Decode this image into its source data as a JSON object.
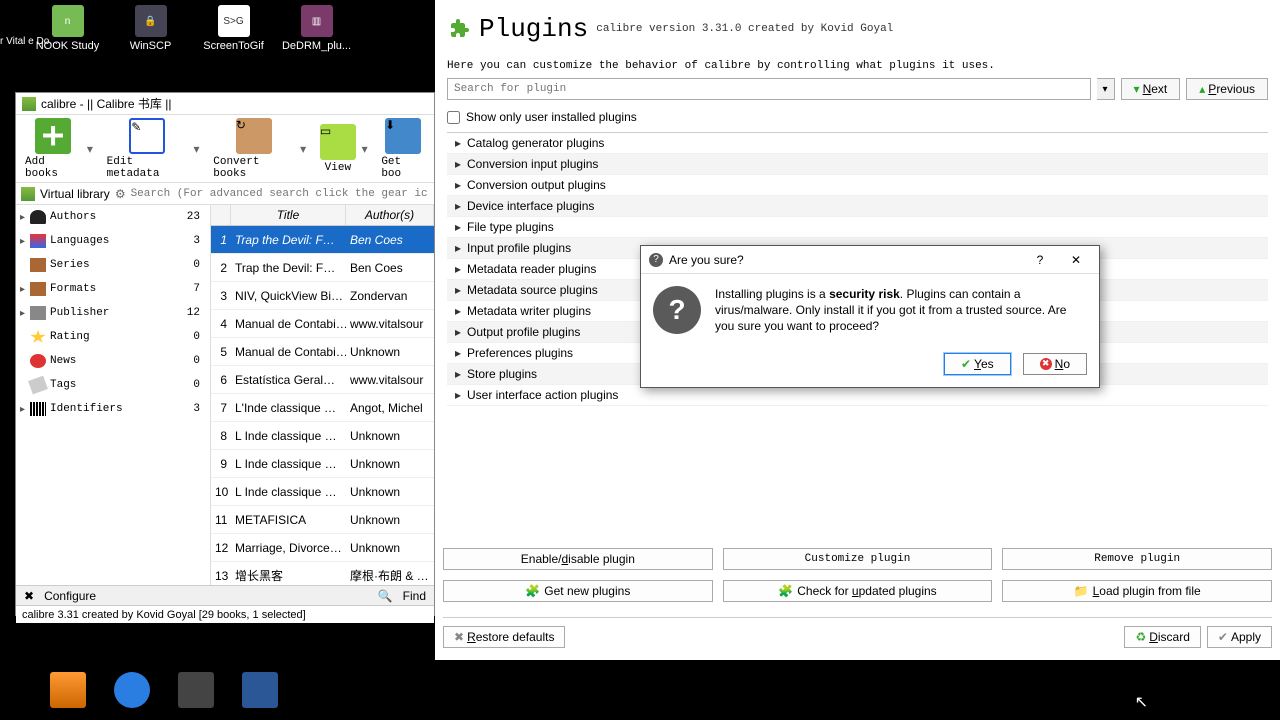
{
  "desktop": {
    "icons": [
      {
        "label": "NOOK Study"
      },
      {
        "label": "WinSCP"
      },
      {
        "label": "ScreenToGif"
      },
      {
        "label": "DeDRM_plu..."
      }
    ],
    "partial_left": "r Vital\ne Do..."
  },
  "calibre": {
    "title": "calibre - || Calibre 书库 ||",
    "toolbar": {
      "add": "Add books",
      "edit": "Edit metadata",
      "convert": "Convert books",
      "view": "View",
      "get": "Get boo"
    },
    "virtual_lib": "Virtual library",
    "search_placeholder": "Search (For advanced search click the gear ic",
    "sidebar": [
      {
        "label": "Authors",
        "count": "23"
      },
      {
        "label": "Languages",
        "count": "3"
      },
      {
        "label": "Series",
        "count": "0"
      },
      {
        "label": "Formats",
        "count": "7"
      },
      {
        "label": "Publisher",
        "count": "12"
      },
      {
        "label": "Rating",
        "count": "0"
      },
      {
        "label": "News",
        "count": "0"
      },
      {
        "label": "Tags",
        "count": "0"
      },
      {
        "label": "Identifiers",
        "count": "3"
      }
    ],
    "cols": {
      "title": "Title",
      "author": "Author(s)"
    },
    "rows": [
      {
        "n": "1",
        "t": "Trap the Devil: F…",
        "a": "Ben Coes"
      },
      {
        "n": "2",
        "t": "Trap the Devil: F…",
        "a": "Ben Coes"
      },
      {
        "n": "3",
        "t": "NIV, QuickView Bi…",
        "a": "Zondervan"
      },
      {
        "n": "4",
        "t": "Manual de Contabi…",
        "a": "www.vitalsour"
      },
      {
        "n": "5",
        "t": "Manual de Contabi…",
        "a": "Unknown"
      },
      {
        "n": "6",
        "t": "Estatística Geral…",
        "a": "www.vitalsour"
      },
      {
        "n": "7",
        "t": "L'Inde classique …",
        "a": "Angot, Michel"
      },
      {
        "n": "8",
        "t": "L Inde classique …",
        "a": "Unknown"
      },
      {
        "n": "9",
        "t": "L Inde classique …",
        "a": "Unknown"
      },
      {
        "n": "10",
        "t": "L Inde classique …",
        "a": "Unknown"
      },
      {
        "n": "11",
        "t": "METAFISICA",
        "a": "Unknown"
      },
      {
        "n": "12",
        "t": "Marriage, Divorce…",
        "a": "Unknown"
      },
      {
        "n": "13",
        "t": "增长黑客",
        "a": "摩根·布朗 & …"
      }
    ],
    "configure": "Configure",
    "find": "Find",
    "status": "calibre 3.31 created by Kovid Goyal   [29 books, 1 selected]"
  },
  "plugins": {
    "title": "Plugins",
    "subtitle": "calibre version 3.31.0 created by Kovid Goyal",
    "desc": "Here you can customize the behavior of calibre by controlling what plugins it uses.",
    "search_placeholder": "Search for plugin",
    "next": "Next",
    "previous": "Previous",
    "show_only": "Show only user installed plugins",
    "categories": [
      "Catalog generator plugins",
      "Conversion input plugins",
      "Conversion output plugins",
      "Device interface plugins",
      "File type plugins",
      "Input profile plugins",
      "Metadata reader plugins",
      "Metadata source plugins",
      "Metadata writer plugins",
      "Output profile plugins",
      "Preferences plugins",
      "Store plugins",
      "User interface action plugins"
    ],
    "enable": "Enable/disable plugin",
    "customize": "Customize plugin",
    "remove": "Remove plugin",
    "get_new": "Get new plugins",
    "check_updates": "Check for updated plugins",
    "load_file": "Load plugin from file",
    "restore": "Restore defaults",
    "discard": "Discard",
    "apply": "Apply"
  },
  "modal": {
    "title": "Are you sure?",
    "body_pre": "Installing plugins is a ",
    "body_bold": "security risk",
    "body_post": ". Plugins can contain a virus/malware. Only install it if you got it from a trusted source. Are you sure you want to proceed?",
    "yes": "Yes",
    "no": "No"
  }
}
